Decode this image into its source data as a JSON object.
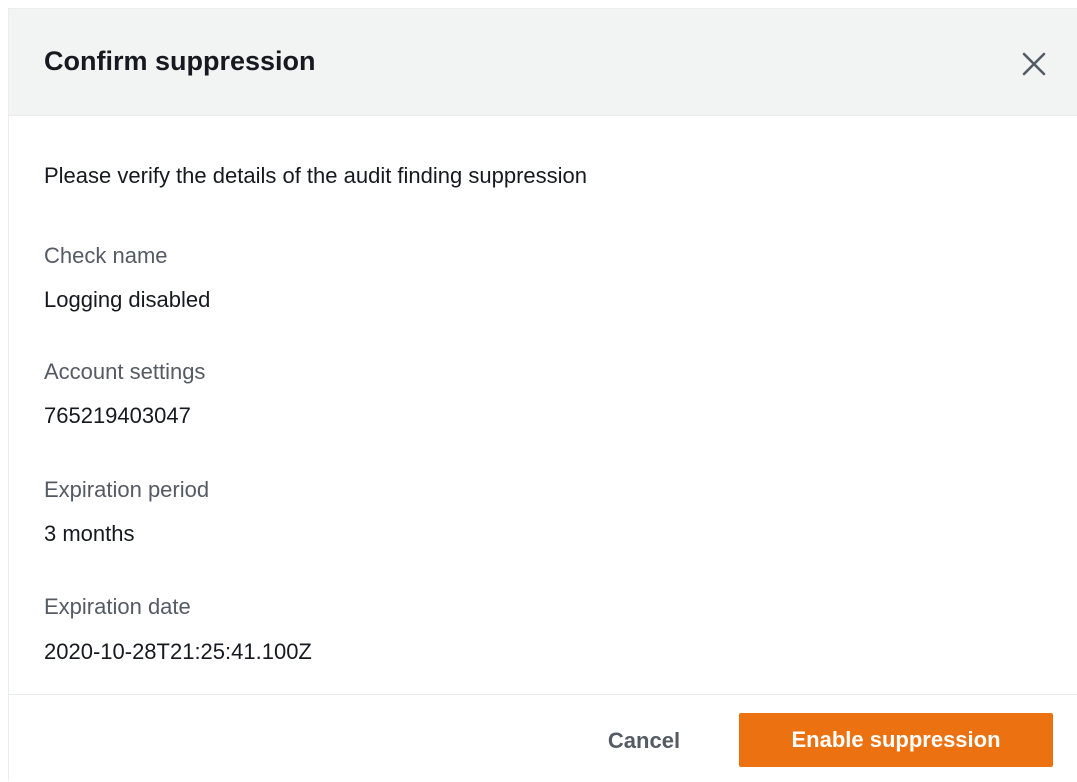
{
  "modal": {
    "title": "Confirm suppression",
    "close_icon": "close-icon"
  },
  "body": {
    "intro": "Please verify the details of the audit finding suppression",
    "fields": [
      {
        "label": "Check name",
        "value": "Logging disabled"
      },
      {
        "label": "Account settings",
        "value": "765219403047"
      },
      {
        "label": "Expiration period",
        "value": "3 months"
      },
      {
        "label": "Expiration date",
        "value": "2020-10-28T21:25:41.100Z"
      }
    ]
  },
  "footer": {
    "cancel_label": "Cancel",
    "confirm_label": "Enable suppression"
  },
  "colors": {
    "primary": "#ec7211",
    "header_bg": "#f2f3f3",
    "label_text": "#545b64",
    "body_text": "#16191f"
  }
}
